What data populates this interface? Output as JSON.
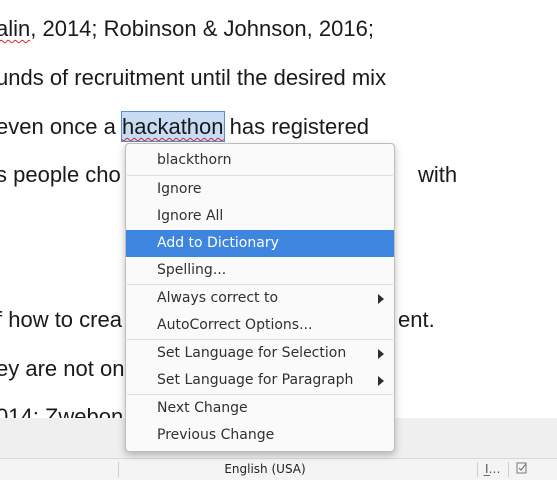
{
  "document": {
    "line1": {
      "a": "alin",
      "b": ", 2014; Robinson & Johnson, 2016;"
    },
    "line2": {
      "text": "unds of recruitment until the desired mix"
    },
    "line3": {
      "a": "even once a ",
      "word": "hackathon",
      "b": " has registered"
    },
    "line4": {
      "a": "s people cho",
      "b": "with"
    },
    "line5": {
      "a": "f how to crea",
      "b": "ent."
    },
    "line6": {
      "a": "ey are not on"
    },
    "line7": {
      "a": "014; Zwebon"
    }
  },
  "context_menu": {
    "suggestion": "blackthorn",
    "ignore": "Ignore",
    "ignore_all": "Ignore All",
    "add_to_dictionary": "Add to Dictionary",
    "spelling": "Spelling...",
    "always_correct_to": "Always correct to",
    "autocorrect_options": "AutoCorrect Options...",
    "set_language_selection": "Set Language for Selection",
    "set_language_paragraph": "Set Language for Paragraph",
    "next_change": "Next Change",
    "previous_change": "Previous Change",
    "highlighted_item": "Add to Dictionary"
  },
  "status_bar": {
    "language": "English (USA)",
    "icon1": "text-cursor-icon",
    "icon2": "document-modified-icon"
  },
  "colors": {
    "highlight": "#3d85de",
    "selection": "#c7dcf3",
    "spell_underline": "#d42a2a"
  }
}
